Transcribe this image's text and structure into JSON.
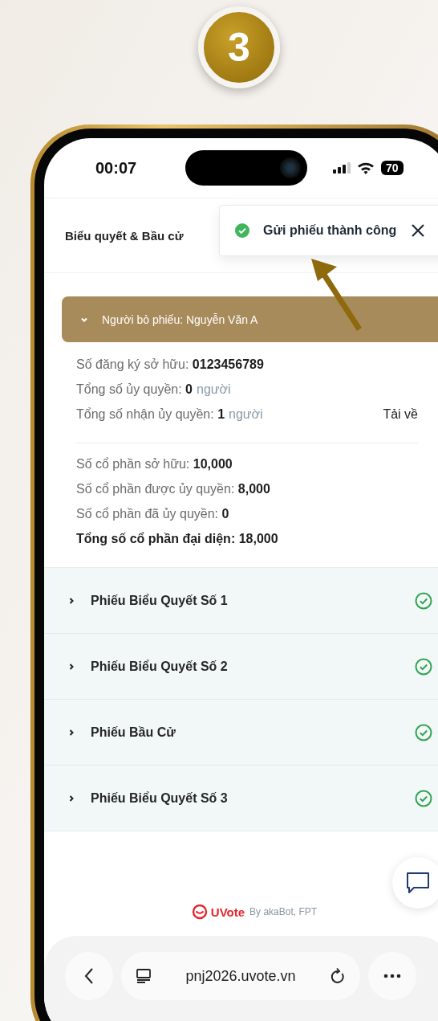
{
  "step_badge": "3",
  "status_bar": {
    "time": "00:07",
    "battery": "70"
  },
  "header": {
    "title": "Biểu quyết & Bầu cử"
  },
  "toast": {
    "message": "Gửi phiếu thành công"
  },
  "voter": {
    "label": "Người bỏ phiếu: Nguyễn Văn A",
    "expanded": true
  },
  "info": [
    {
      "label": "Số đăng ký sở hữu:",
      "value": "0123456789"
    },
    {
      "label": "Tổng số ủy quyền:",
      "value": "0",
      "unit": "người"
    },
    {
      "label": "Tổng số nhận ủy quyền:",
      "value": "1",
      "unit": "người",
      "action": "Tải về"
    }
  ],
  "shares": [
    {
      "label": "Số cổ phần sở hữu:",
      "value": "10,000",
      "kind": "normal"
    },
    {
      "label": "Số cổ phần được ủy quyền:",
      "value": "8,000",
      "kind": "normal"
    },
    {
      "label": "Số cổ phần đã ủy quyền:",
      "value": "0",
      "kind": "normal"
    },
    {
      "label": "Tổng số cổ phần đại diện:",
      "value": "18,000",
      "kind": "total"
    }
  ],
  "ballots": [
    {
      "title": "Phiếu Biểu Quyết Số 1",
      "expanded": false,
      "completed": true
    },
    {
      "title": "Phiếu Biểu Quyết Số 2",
      "expanded": false,
      "completed": true
    },
    {
      "title": "Phiếu Bầu Cử",
      "expanded": false,
      "completed": true
    },
    {
      "title": "Phiếu Biểu Quyết Số 3",
      "expanded": false,
      "completed": true
    }
  ],
  "footer": {
    "brand": "UVote",
    "credit": "By akaBot, FPT"
  },
  "browser": {
    "url": "pnj2026.uvote.vn"
  }
}
